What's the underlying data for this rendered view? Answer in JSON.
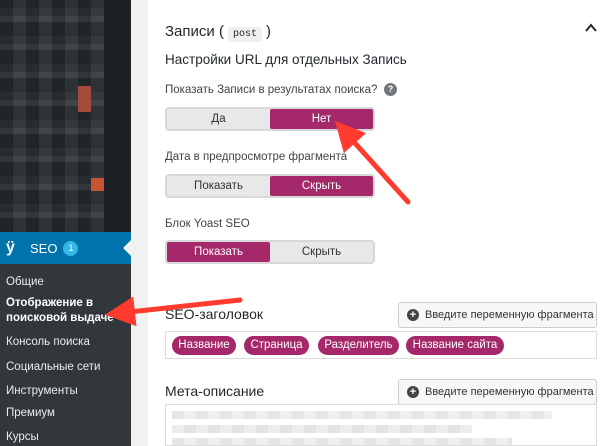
{
  "colors": {
    "sidebar": "#23282d",
    "accent": "#a4286a",
    "wp_blue": "#0073aa",
    "arrow": "#ff3b30"
  },
  "sidebar": {
    "seo_label": "SEO",
    "seo_badge": "1",
    "items": [
      {
        "label": "Общие"
      },
      {
        "label": "Отображение в поисковой выдаче",
        "active": true
      },
      {
        "label": "Консоль поиска"
      },
      {
        "label": "Социальные сети"
      },
      {
        "label": "Инструменты"
      },
      {
        "label": "Премиум"
      },
      {
        "label": "Курсы"
      }
    ]
  },
  "panel": {
    "title_prefix": "Записи (",
    "title_code": "post",
    "title_suffix": ")",
    "url_heading": "Настройки URL для отдельных Запись",
    "show_in_search": {
      "label": "Показать Записи в результатах поиска?",
      "options": [
        "Да",
        "Нет"
      ],
      "selected": "Нет"
    },
    "date_preview": {
      "label": "Дата в предпросмотре фрагмента",
      "options": [
        "Показать",
        "Скрыть"
      ],
      "selected": "Скрыть"
    },
    "yoast_block": {
      "label": "Блок Yoast SEO",
      "options": [
        "Показать",
        "Скрыть"
      ],
      "selected": "Показать"
    },
    "seo_title": {
      "label": "SEO-заголовок",
      "insert_button": "Введите переменную фрагмента",
      "tags": [
        "Название",
        "Страница",
        "Разделитель",
        "Название сайта"
      ]
    },
    "meta_desc": {
      "label": "Мета-описание",
      "insert_button": "Введите переменную фрагмента"
    }
  }
}
